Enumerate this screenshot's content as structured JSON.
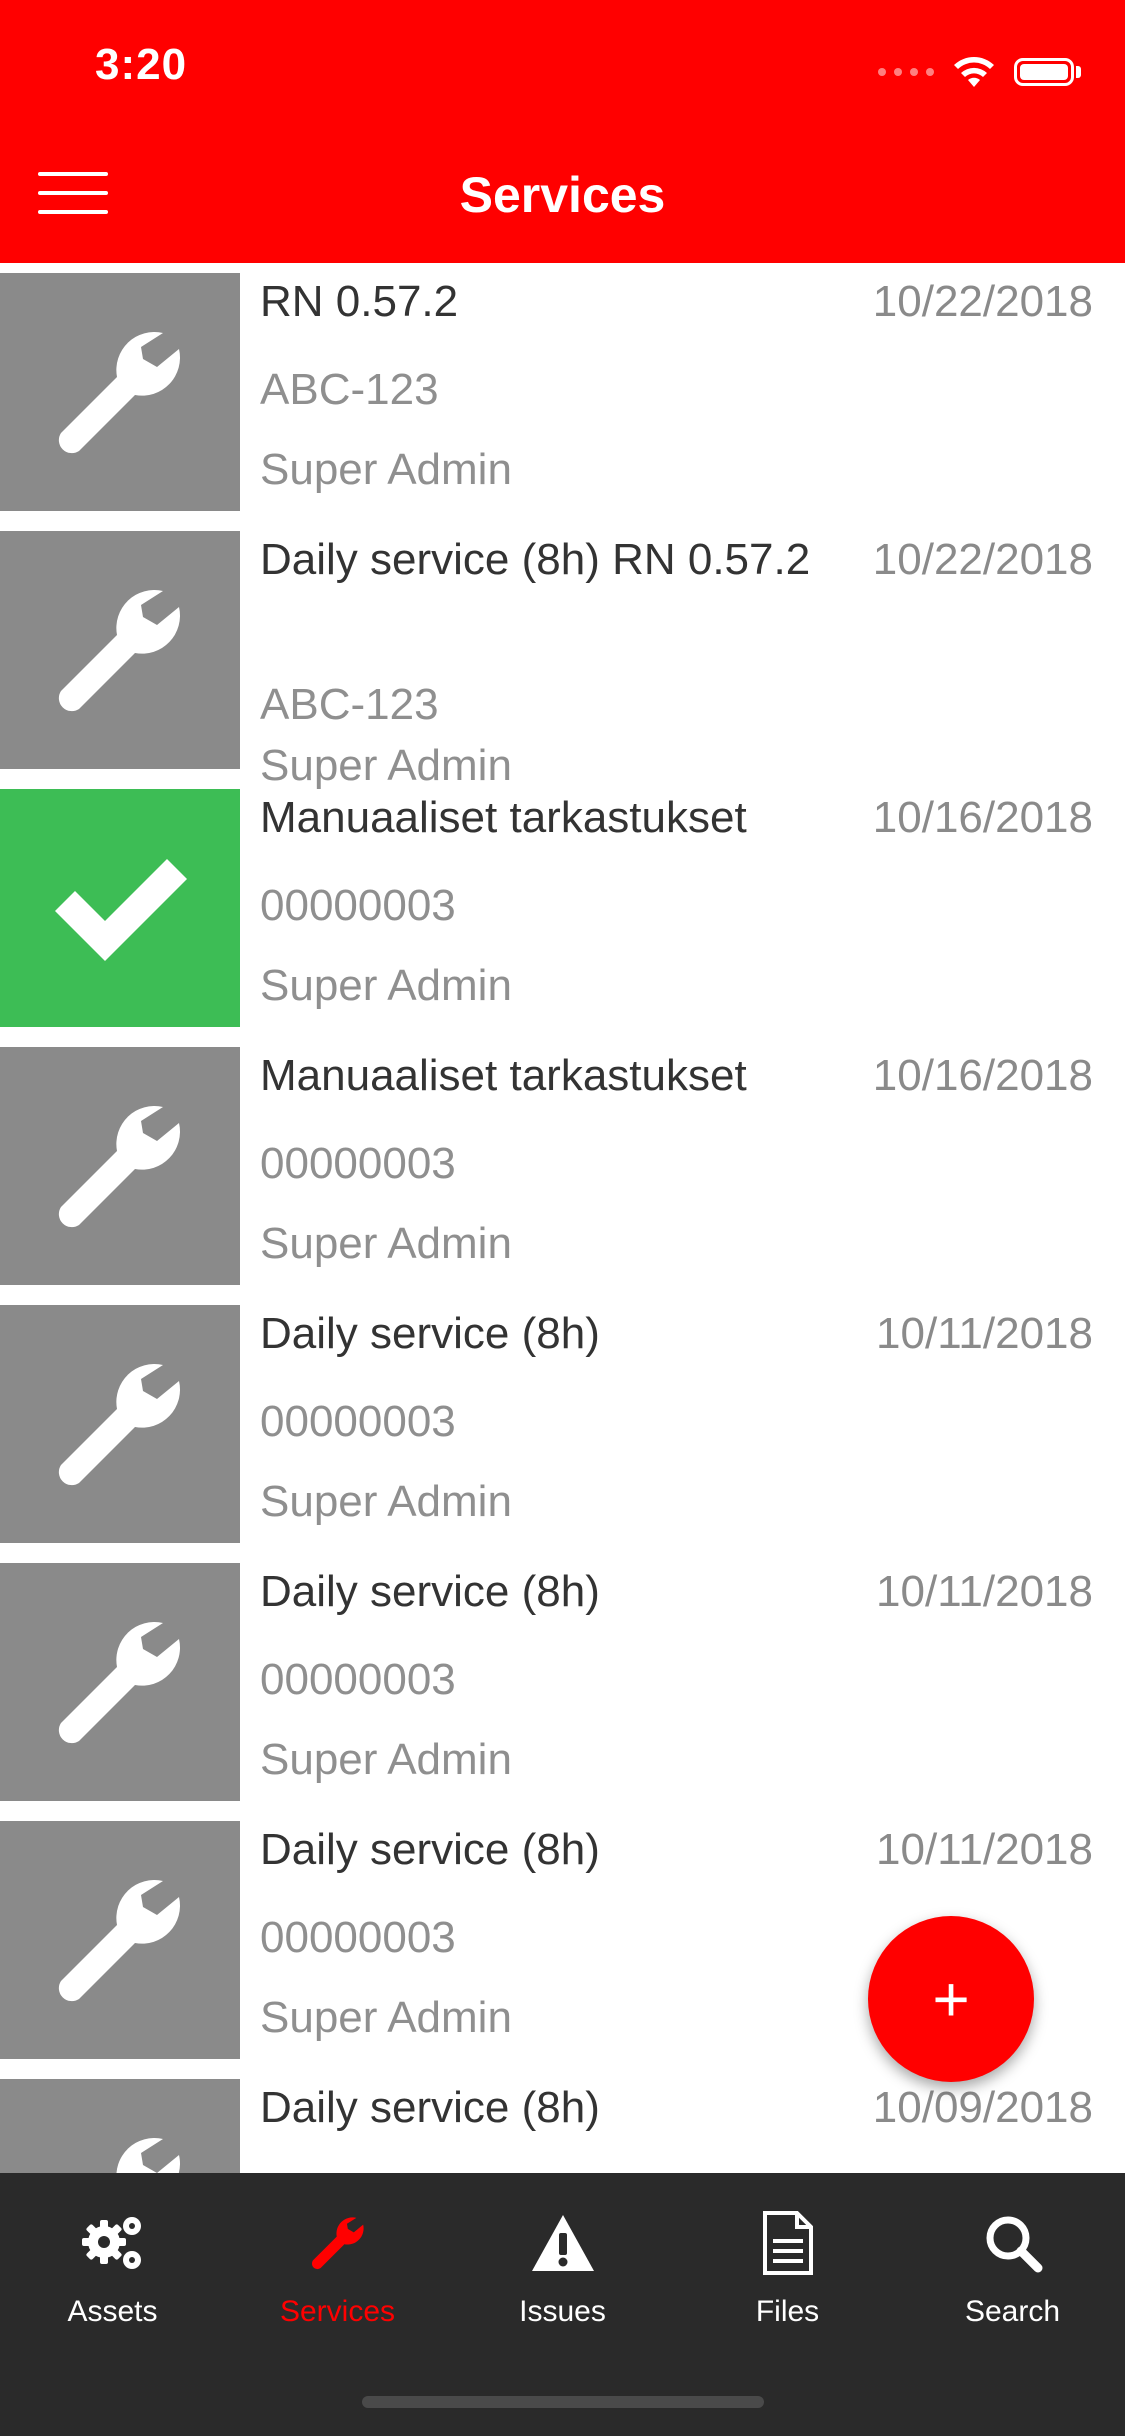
{
  "status_bar": {
    "time": "3:20"
  },
  "header": {
    "title": "Services"
  },
  "services": [
    {
      "title": "RN 0.57.2",
      "date": "10/22/2018",
      "code": "ABC-123",
      "user": "Super Admin",
      "status": "wrench-icon"
    },
    {
      "title": "Daily service (8h) RN 0.57.2",
      "date": "10/22/2018",
      "code": "ABC-123",
      "user": "Super Admin",
      "status": "wrench-icon"
    },
    {
      "title": "Manuaaliset tarkastukset",
      "date": "10/16/2018",
      "code": "00000003",
      "user": "Super Admin",
      "status": "checkmark-icon"
    },
    {
      "title": "Manuaaliset tarkastukset",
      "date": "10/16/2018",
      "code": "00000003",
      "user": "Super Admin",
      "status": "wrench-icon"
    },
    {
      "title": "Daily service (8h)",
      "date": "10/11/2018",
      "code": "00000003",
      "user": "Super Admin",
      "status": "wrench-icon"
    },
    {
      "title": "Daily service (8h)",
      "date": "10/11/2018",
      "code": "00000003",
      "user": "Super Admin",
      "status": "wrench-icon"
    },
    {
      "title": "Daily service (8h)",
      "date": "10/11/2018",
      "code": "00000003",
      "user": "Super Admin",
      "status": "wrench-icon"
    },
    {
      "title": "Daily service (8h)",
      "date": "10/09/2018",
      "code": "",
      "user": "",
      "status": "wrench-icon"
    }
  ],
  "fab": {
    "label": "+"
  },
  "tabs": [
    {
      "label": "Assets",
      "icon": "gears-icon"
    },
    {
      "label": "Services",
      "icon": "wrench-icon"
    },
    {
      "label": "Issues",
      "icon": "warning-icon"
    },
    {
      "label": "Files",
      "icon": "file-icon"
    },
    {
      "label": "Search",
      "icon": "search-icon"
    }
  ],
  "colors": {
    "brand": "#ff0000",
    "done": "#3dbd55",
    "thumb": "#8a8a8a",
    "tabbar": "#2a2a2a"
  }
}
